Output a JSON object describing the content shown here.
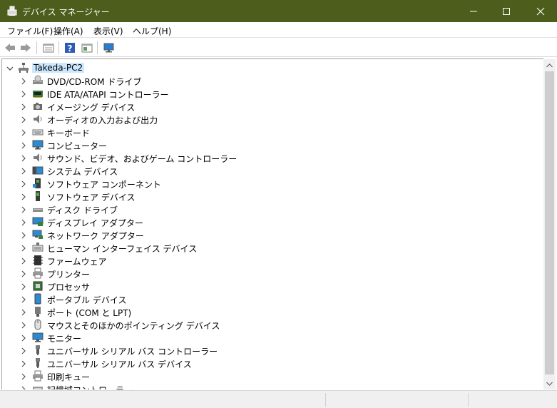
{
  "window": {
    "title": "デバイス マネージャー",
    "title_bg": "#4c5d1c"
  },
  "menu": [
    "ファイル(F)",
    "操作(A)",
    "表示(V)",
    "ヘルプ(H)"
  ],
  "toolbar": {
    "buttons": [
      "back-arrow-icon",
      "forward-arrow-icon",
      "properties-icon",
      "help-icon",
      "show-hide-tree-icon",
      "monitor-scan-icon"
    ]
  },
  "tree": {
    "root": "Takeda-PC2",
    "selection_color": "#cce8ff",
    "items": [
      {
        "label": "DVD/CD-ROM ドライブ",
        "icon": "dvd-drive-icon"
      },
      {
        "label": "IDE ATA/ATAPI コントローラー",
        "icon": "ide-controller-icon"
      },
      {
        "label": "イメージング デバイス",
        "icon": "camera-icon"
      },
      {
        "label": "オーディオの入力および出力",
        "icon": "speaker-icon"
      },
      {
        "label": "キーボード",
        "icon": "keyboard-icon"
      },
      {
        "label": "コンピューター",
        "icon": "computer-icon"
      },
      {
        "label": "サウンド、ビデオ、およびゲーム コントローラー",
        "icon": "sound-icon"
      },
      {
        "label": "システム デバイス",
        "icon": "system-device-icon"
      },
      {
        "label": "ソフトウェア コンポーネント",
        "icon": "software-component-icon"
      },
      {
        "label": "ソフトウェア デバイス",
        "icon": "software-device-icon"
      },
      {
        "label": "ディスク ドライブ",
        "icon": "disk-drive-icon"
      },
      {
        "label": "ディスプレイ アダプター",
        "icon": "display-adapter-icon"
      },
      {
        "label": "ネットワーク アダプター",
        "icon": "network-adapter-icon"
      },
      {
        "label": "ヒューマン インターフェイス デバイス",
        "icon": "hid-icon"
      },
      {
        "label": "ファームウェア",
        "icon": "firmware-icon"
      },
      {
        "label": "プリンター",
        "icon": "printer-icon"
      },
      {
        "label": "プロセッサ",
        "icon": "processor-icon"
      },
      {
        "label": "ポータブル デバイス",
        "icon": "portable-device-icon"
      },
      {
        "label": "ポート (COM と LPT)",
        "icon": "port-icon"
      },
      {
        "label": "マウスとそのほかのポインティング デバイス",
        "icon": "mouse-icon"
      },
      {
        "label": "モニター",
        "icon": "monitor-icon"
      },
      {
        "label": "ユニバーサル シリアル バス コントローラー",
        "icon": "usb-icon"
      },
      {
        "label": "ユニバーサル シリアル バス デバイス",
        "icon": "usb-device-icon"
      },
      {
        "label": "印刷キュー",
        "icon": "print-queue-icon"
      },
      {
        "label": "記憶域コントローラー",
        "icon": "storage-controller-icon"
      }
    ]
  }
}
